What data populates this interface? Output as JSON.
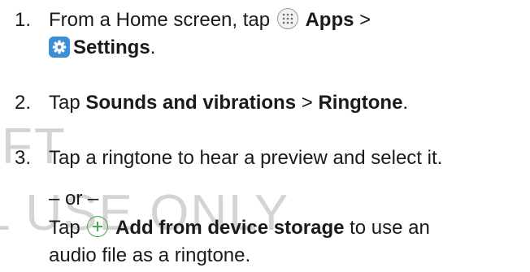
{
  "watermark": {
    "line1": "FT",
    "line2": "L USE ONLY"
  },
  "steps": [
    {
      "number": "1.",
      "line1_pre": "From a Home screen, tap",
      "apps_label": "Apps",
      "line1_post": ">",
      "settings_label": "Settings",
      "settings_end": "."
    },
    {
      "number": "2.",
      "pre": "Tap",
      "sounds_label": "Sounds and vibrations",
      "sep": ">",
      "ringtone_label": "Ringtone",
      "end": "."
    },
    {
      "number": "3.",
      "text": "Tap a ringtone to hear a preview and select it."
    }
  ],
  "or_text": "– or –",
  "add_step": {
    "pre": "Tap",
    "add_label": "Add from device storage",
    "post": "to use an",
    "line2": "audio file as a ringtone."
  },
  "icons": {
    "apps": "apps-grid-icon",
    "settings": "settings-gear-icon",
    "add": "plus-circle-icon"
  },
  "colors": {
    "text": "#1a1a1a",
    "watermark": "#d4d4d4",
    "settings_icon_bg": "#3b8fd6",
    "plus_icon": "#3fae49"
  }
}
